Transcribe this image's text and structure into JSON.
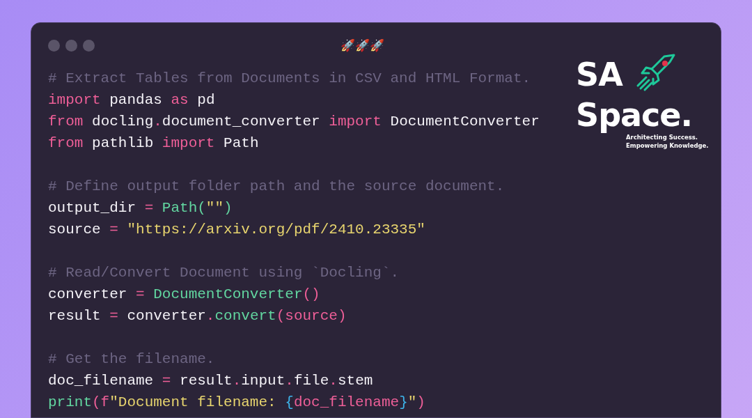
{
  "window": {
    "title": "🚀🚀🚀"
  },
  "code": [
    {
      "kind": "code",
      "tokens": [
        {
          "t": "# Extract Tables from Documents in CSV and HTML Format.",
          "kind": "comment"
        }
      ]
    },
    {
      "kind": "code",
      "tokens": [
        {
          "t": "import",
          "kind": "keyword"
        },
        {
          "t": " pandas ",
          "kind": "plain"
        },
        {
          "t": "as",
          "kind": "keyword"
        },
        {
          "t": " pd",
          "kind": "plain"
        }
      ]
    },
    {
      "kind": "code",
      "tokens": [
        {
          "t": "from",
          "kind": "keyword"
        },
        {
          "t": " docling",
          "kind": "plain"
        },
        {
          "t": ".",
          "kind": "keyword"
        },
        {
          "t": "document_converter ",
          "kind": "plain"
        },
        {
          "t": "import",
          "kind": "keyword"
        },
        {
          "t": " DocumentConverter",
          "kind": "plain"
        }
      ]
    },
    {
      "kind": "code",
      "tokens": [
        {
          "t": "from",
          "kind": "keyword"
        },
        {
          "t": " pathlib ",
          "kind": "plain"
        },
        {
          "t": "import",
          "kind": "keyword"
        },
        {
          "t": " Path",
          "kind": "plain"
        }
      ]
    },
    {
      "kind": "blank"
    },
    {
      "kind": "code",
      "tokens": [
        {
          "t": "# Define output folder path and the source document.",
          "kind": "comment"
        }
      ]
    },
    {
      "kind": "code",
      "tokens": [
        {
          "t": "output_dir ",
          "kind": "plain"
        },
        {
          "t": "= ",
          "kind": "keyword"
        },
        {
          "t": "Path(",
          "kind": "func"
        },
        {
          "t": "\"\"",
          "kind": "string"
        },
        {
          "t": ")",
          "kind": "func"
        }
      ]
    },
    {
      "kind": "code",
      "tokens": [
        {
          "t": "source ",
          "kind": "plain"
        },
        {
          "t": "= ",
          "kind": "keyword"
        },
        {
          "t": "\"https://arxiv.org/pdf/2410.23335\"",
          "kind": "string"
        }
      ]
    },
    {
      "kind": "blank"
    },
    {
      "kind": "code",
      "tokens": [
        {
          "t": "# Read/Convert Document using `Docling`.",
          "kind": "comment"
        }
      ]
    },
    {
      "kind": "code",
      "tokens": [
        {
          "t": "converter ",
          "kind": "plain"
        },
        {
          "t": "= ",
          "kind": "keyword"
        },
        {
          "t": "DocumentConverter",
          "kind": "func"
        },
        {
          "t": "()",
          "kind": "keyword"
        }
      ]
    },
    {
      "kind": "code",
      "tokens": [
        {
          "t": "result ",
          "kind": "plain"
        },
        {
          "t": "=",
          "kind": "keyword"
        },
        {
          "t": " converter",
          "kind": "plain"
        },
        {
          "t": ".",
          "kind": "keyword"
        },
        {
          "t": "convert",
          "kind": "func"
        },
        {
          "t": "(source)",
          "kind": "keyword"
        }
      ]
    },
    {
      "kind": "blank"
    },
    {
      "kind": "code",
      "tokens": [
        {
          "t": "# Get the filename.",
          "kind": "comment"
        }
      ]
    },
    {
      "kind": "code",
      "tokens": [
        {
          "t": "doc_filename ",
          "kind": "plain"
        },
        {
          "t": "=",
          "kind": "keyword"
        },
        {
          "t": " result",
          "kind": "plain"
        },
        {
          "t": ".",
          "kind": "keyword"
        },
        {
          "t": "input",
          "kind": "plain"
        },
        {
          "t": ".",
          "kind": "keyword"
        },
        {
          "t": "file",
          "kind": "plain"
        },
        {
          "t": ".",
          "kind": "keyword"
        },
        {
          "t": "stem",
          "kind": "plain"
        }
      ]
    },
    {
      "kind": "code",
      "tokens": [
        {
          "t": "print",
          "kind": "func"
        },
        {
          "t": "(f",
          "kind": "keyword"
        },
        {
          "t": "\"Document filename: ",
          "kind": "string"
        },
        {
          "t": "{",
          "kind": "brace"
        },
        {
          "t": "doc_filename",
          "kind": "keyword"
        },
        {
          "t": "}",
          "kind": "brace"
        },
        {
          "t": "\"",
          "kind": "string"
        },
        {
          "t": ")",
          "kind": "keyword"
        }
      ]
    }
  ],
  "logo": {
    "line_1": "SA",
    "line_2": "Space.",
    "tagline": [
      "Architecting Success.",
      "Empowering Knowledge."
    ]
  }
}
